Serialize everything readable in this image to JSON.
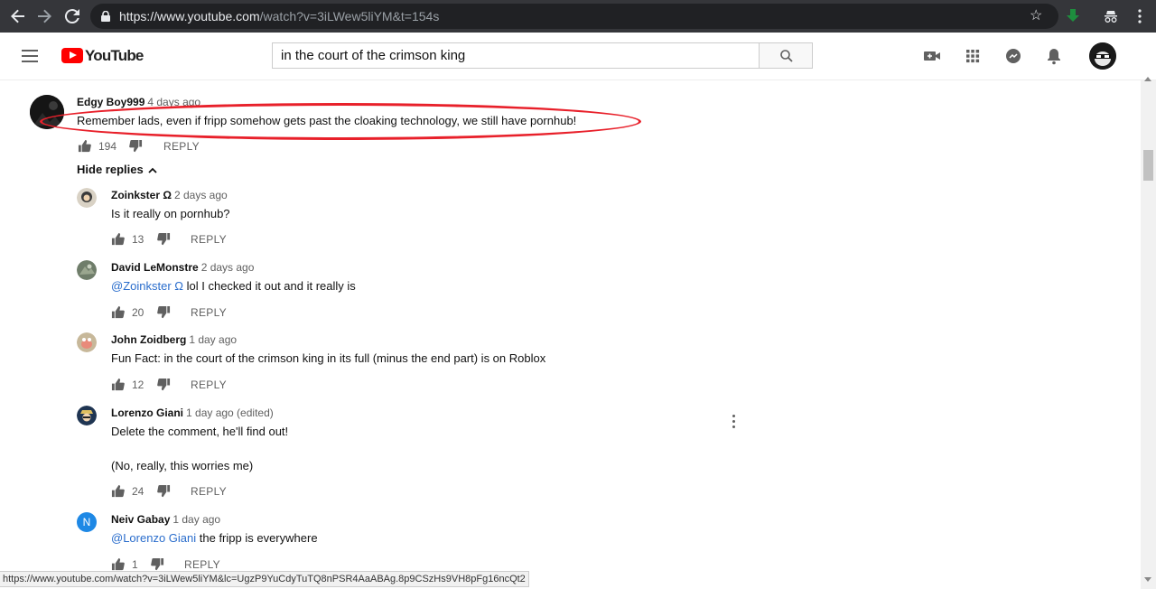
{
  "browser": {
    "url_main": "https://www.youtube.com",
    "url_rest": "/watch?v=3iLWew5liYM&t=154s",
    "status_url": "https://www.youtube.com/watch?v=3iLWew5liYM&lc=UgzP9YuCdyTuTQ8nPSR4AaABAg.8p9CSzHs9VH8pFg16ncQt2"
  },
  "masthead": {
    "logo_text": "YouTube",
    "search_value": "in the court of the crimson king",
    "icons": [
      "menu-icon",
      "create-video-icon",
      "apps-icon",
      "messages-icon",
      "notifications-icon",
      "account-avatar"
    ]
  },
  "comment": {
    "author": "Edgy Boy999",
    "time": "4 days ago",
    "text": "Remember lads, even if fripp somehow gets past the cloaking technology, we still have pornhub!",
    "likes": "194",
    "reply_label": "REPLY"
  },
  "hide_replies_label": "Hide replies",
  "replies": [
    {
      "author": "Zoinkster Ω",
      "time": "2 days ago",
      "mention": "",
      "text": "Is it really on pornhub?",
      "likes": "13",
      "reply_label": "REPLY"
    },
    {
      "author": "David LeMonstre",
      "time": "2 days ago",
      "mention": "@Zoinkster Ω",
      "text": "lol I checked it out and it really is",
      "likes": "20",
      "reply_label": "REPLY"
    },
    {
      "author": "John Zoidberg",
      "time": "1 day ago",
      "mention": "",
      "text": "Fun Fact: in the court of the crimson king in its full (minus the end part) is on Roblox",
      "likes": "12",
      "reply_label": "REPLY"
    },
    {
      "author": "Lorenzo Giani",
      "time": "1 day ago (edited)",
      "mention": "",
      "text": "Delete the comment, he'll find out!",
      "text2": "(No, really, this worries me)",
      "likes": "24",
      "reply_label": "REPLY"
    },
    {
      "author": "Neiv Gabay",
      "time": "1 day ago",
      "mention": "@Lorenzo Giani",
      "text": "the fripp is everywhere",
      "likes": "1",
      "reply_label": "REPLY",
      "avatar_letter": "N"
    }
  ],
  "colors": {
    "brand_red": "#ff0000",
    "mention_blue": "#2a6dcc",
    "annotation_red": "#e8202a",
    "chrome_dark": "#35363a"
  }
}
